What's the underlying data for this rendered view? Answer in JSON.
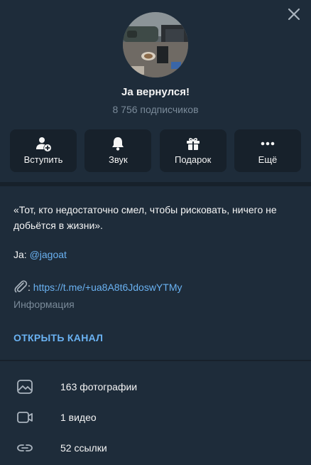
{
  "colors": {
    "accent": "#6ab2f2",
    "muted": "#7a8a99",
    "panel": "#1e2c3a",
    "background": "#17212b"
  },
  "header": {
    "close_icon": "close-icon",
    "title": "Ja вернулся!",
    "subscribers": "8 756 подписчиков"
  },
  "actions": [
    {
      "icon": "user-plus-icon",
      "label": "Вступить"
    },
    {
      "icon": "bell-icon",
      "label": "Звук"
    },
    {
      "icon": "gift-icon",
      "label": "Подарок"
    },
    {
      "icon": "more-icon",
      "label": "Ещё"
    }
  ],
  "info": {
    "about": "«Тот, кто недостаточно смел, чтобы рисковать, ничего не добьётся в жизни».",
    "ja_prefix": "Ja: ",
    "ja_handle": "@jagoat",
    "link_prefix": ": ",
    "link": "https://t.me/+ua8A8t6JdoswYTMy",
    "info_label": "Информация",
    "open_channel": "ОТКРЫТЬ КАНАЛ"
  },
  "media": [
    {
      "icon": "photo-icon",
      "label": "163 фотографии"
    },
    {
      "icon": "video-icon",
      "label": "1 видео"
    },
    {
      "icon": "link-icon",
      "label": "52 ссылки"
    }
  ]
}
